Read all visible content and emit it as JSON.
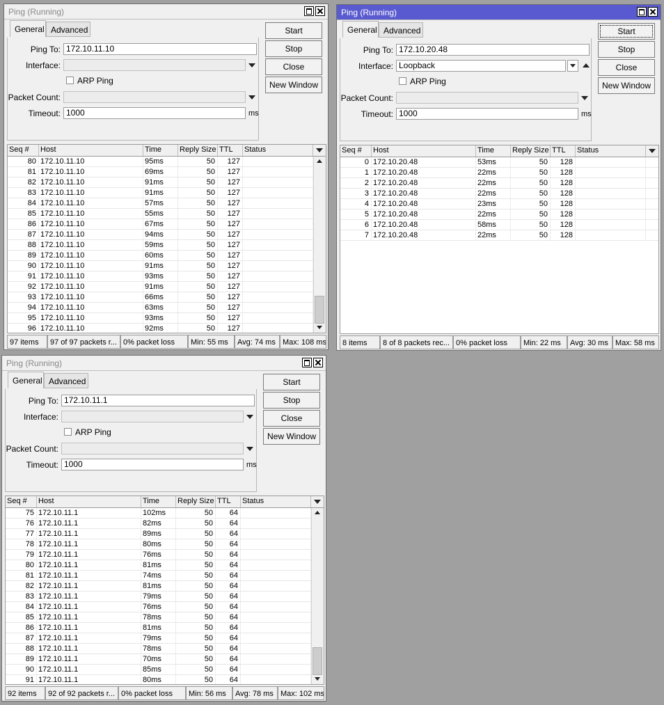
{
  "windows": [
    {
      "title": "Ping (Running)",
      "tabs": [
        "General",
        "Advanced"
      ],
      "labels": {
        "ping_to": "Ping To:",
        "interface": "Interface:",
        "arp_ping": "ARP Ping",
        "packet_count": "Packet Count:",
        "timeout": "Timeout:",
        "ms": "ms"
      },
      "ping_to": "172.10.11.10",
      "interface": "",
      "packet_count": "",
      "timeout": "1000",
      "buttons": {
        "start": "Start",
        "stop": "Stop",
        "close": "Close",
        "new_window": "New Window"
      },
      "columns": [
        "Seq #",
        "Host",
        "Time",
        "Reply Size",
        "TTL",
        "Status"
      ],
      "rows": [
        [
          "80",
          "172.10.11.10",
          "95ms",
          "50",
          "127",
          ""
        ],
        [
          "81",
          "172.10.11.10",
          "69ms",
          "50",
          "127",
          ""
        ],
        [
          "82",
          "172.10.11.10",
          "91ms",
          "50",
          "127",
          ""
        ],
        [
          "83",
          "172.10.11.10",
          "91ms",
          "50",
          "127",
          ""
        ],
        [
          "84",
          "172.10.11.10",
          "57ms",
          "50",
          "127",
          ""
        ],
        [
          "85",
          "172.10.11.10",
          "55ms",
          "50",
          "127",
          ""
        ],
        [
          "86",
          "172.10.11.10",
          "67ms",
          "50",
          "127",
          ""
        ],
        [
          "87",
          "172.10.11.10",
          "94ms",
          "50",
          "127",
          ""
        ],
        [
          "88",
          "172.10.11.10",
          "59ms",
          "50",
          "127",
          ""
        ],
        [
          "89",
          "172.10.11.10",
          "60ms",
          "50",
          "127",
          ""
        ],
        [
          "90",
          "172.10.11.10",
          "91ms",
          "50",
          "127",
          ""
        ],
        [
          "91",
          "172.10.11.10",
          "93ms",
          "50",
          "127",
          ""
        ],
        [
          "92",
          "172.10.11.10",
          "91ms",
          "50",
          "127",
          ""
        ],
        [
          "93",
          "172.10.11.10",
          "66ms",
          "50",
          "127",
          ""
        ],
        [
          "94",
          "172.10.11.10",
          "63ms",
          "50",
          "127",
          ""
        ],
        [
          "95",
          "172.10.11.10",
          "93ms",
          "50",
          "127",
          ""
        ],
        [
          "96",
          "172.10.11.10",
          "92ms",
          "50",
          "127",
          ""
        ]
      ],
      "status": {
        "items": "97 items",
        "packets": "97 of 97 packets r...",
        "loss": "0% packet loss",
        "min": "Min: 55 ms",
        "avg": "Avg: 74 ms",
        "max": "Max: 108 ms"
      }
    },
    {
      "title": "Ping (Running)",
      "tabs": [
        "General",
        "Advanced"
      ],
      "labels": {
        "ping_to": "Ping To:",
        "interface": "Interface:",
        "arp_ping": "ARP Ping",
        "packet_count": "Packet Count:",
        "timeout": "Timeout:",
        "ms": "ms"
      },
      "ping_to": "172.10.20.48",
      "interface": "Loopback",
      "packet_count": "",
      "timeout": "1000",
      "buttons": {
        "start": "Start",
        "stop": "Stop",
        "close": "Close",
        "new_window": "New Window"
      },
      "columns": [
        "Seq #",
        "Host",
        "Time",
        "Reply Size",
        "TTL",
        "Status"
      ],
      "rows": [
        [
          "0",
          "172.10.20.48",
          "53ms",
          "50",
          "128",
          ""
        ],
        [
          "1",
          "172.10.20.48",
          "22ms",
          "50",
          "128",
          ""
        ],
        [
          "2",
          "172.10.20.48",
          "22ms",
          "50",
          "128",
          ""
        ],
        [
          "3",
          "172.10.20.48",
          "22ms",
          "50",
          "128",
          ""
        ],
        [
          "4",
          "172.10.20.48",
          "23ms",
          "50",
          "128",
          ""
        ],
        [
          "5",
          "172.10.20.48",
          "22ms",
          "50",
          "128",
          ""
        ],
        [
          "6",
          "172.10.20.48",
          "58ms",
          "50",
          "128",
          ""
        ],
        [
          "7",
          "172.10.20.48",
          "22ms",
          "50",
          "128",
          ""
        ]
      ],
      "status": {
        "items": "8 items",
        "packets": "8 of 8 packets rec...",
        "loss": "0% packet loss",
        "min": "Min: 22 ms",
        "avg": "Avg: 30 ms",
        "max": "Max: 58 ms"
      }
    },
    {
      "title": "Ping (Running)",
      "tabs": [
        "General",
        "Advanced"
      ],
      "labels": {
        "ping_to": "Ping To:",
        "interface": "Interface:",
        "arp_ping": "ARP Ping",
        "packet_count": "Packet Count:",
        "timeout": "Timeout:",
        "ms": "ms"
      },
      "ping_to": "172.10.11.1",
      "interface": "",
      "packet_count": "",
      "timeout": "1000",
      "buttons": {
        "start": "Start",
        "stop": "Stop",
        "close": "Close",
        "new_window": "New Window"
      },
      "columns": [
        "Seq #",
        "Host",
        "Time",
        "Reply Size",
        "TTL",
        "Status"
      ],
      "rows": [
        [
          "75",
          "172.10.11.1",
          "102ms",
          "50",
          "64",
          ""
        ],
        [
          "76",
          "172.10.11.1",
          "82ms",
          "50",
          "64",
          ""
        ],
        [
          "77",
          "172.10.11.1",
          "89ms",
          "50",
          "64",
          ""
        ],
        [
          "78",
          "172.10.11.1",
          "80ms",
          "50",
          "64",
          ""
        ],
        [
          "79",
          "172.10.11.1",
          "76ms",
          "50",
          "64",
          ""
        ],
        [
          "80",
          "172.10.11.1",
          "81ms",
          "50",
          "64",
          ""
        ],
        [
          "81",
          "172.10.11.1",
          "74ms",
          "50",
          "64",
          ""
        ],
        [
          "82",
          "172.10.11.1",
          "81ms",
          "50",
          "64",
          ""
        ],
        [
          "83",
          "172.10.11.1",
          "79ms",
          "50",
          "64",
          ""
        ],
        [
          "84",
          "172.10.11.1",
          "76ms",
          "50",
          "64",
          ""
        ],
        [
          "85",
          "172.10.11.1",
          "78ms",
          "50",
          "64",
          ""
        ],
        [
          "86",
          "172.10.11.1",
          "81ms",
          "50",
          "64",
          ""
        ],
        [
          "87",
          "172.10.11.1",
          "79ms",
          "50",
          "64",
          ""
        ],
        [
          "88",
          "172.10.11.1",
          "78ms",
          "50",
          "64",
          ""
        ],
        [
          "89",
          "172.10.11.1",
          "70ms",
          "50",
          "64",
          ""
        ],
        [
          "90",
          "172.10.11.1",
          "85ms",
          "50",
          "64",
          ""
        ],
        [
          "91",
          "172.10.11.1",
          "80ms",
          "50",
          "64",
          ""
        ]
      ],
      "status": {
        "items": "92 items",
        "packets": "92 of 92 packets r...",
        "loss": "0% packet loss",
        "min": "Min: 56 ms",
        "avg": "Avg: 78 ms",
        "max": "Max: 102 ms"
      }
    }
  ]
}
